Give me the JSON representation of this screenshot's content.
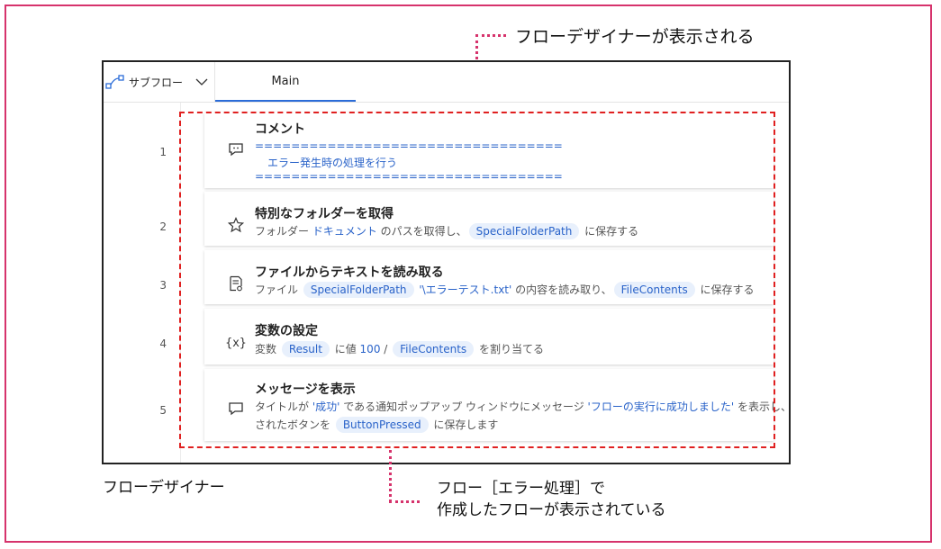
{
  "annotations": {
    "top_callout": "フローデザイナーが表示される",
    "designer_label": "フローデザイナー",
    "bottom_callout_line1": "フロー［エラー処理］で",
    "bottom_callout_line2": "作成したフローが表示されている"
  },
  "tabs": {
    "subflow_label": "サブフロー",
    "main_label": "Main"
  },
  "actions": [
    {
      "line": "1",
      "icon": "comment-icon",
      "title": "コメント",
      "separator": "==================================",
      "body": "エラー発生時の処理を行う"
    },
    {
      "line": "2",
      "icon": "star-icon",
      "title": "特別なフォルダーを取得",
      "desc": {
        "pre": "フォルダー ",
        "folder": "ドキュメント",
        "mid": " のパスを取得し、",
        "var": "SpecialFolderPath",
        "post": " に保存する"
      }
    },
    {
      "line": "3",
      "icon": "file-read-icon",
      "title": "ファイルからテキストを読み取る",
      "desc": {
        "pre": "ファイル ",
        "var1": "SpecialFolderPath",
        "path": " '\\エラーテスト.txt'",
        "mid": " の内容を読み取り、",
        "var2": "FileContents",
        "post": " に保存する"
      }
    },
    {
      "line": "4",
      "icon": "variable-icon",
      "title": "変数の設定",
      "desc": {
        "pre": "変数 ",
        "var1": "Result",
        "mid1": " に値 ",
        "value": "100",
        "mid2": " / ",
        "var2": "FileContents",
        "post": " を割り当てる"
      }
    },
    {
      "line": "5",
      "icon": "message-icon",
      "title": "メッセージを表示",
      "desc": {
        "pre": "タイトルが ",
        "title_val": "'成功'",
        "mid1": " である通知ポップアップ ウィンドウにメッセージ ",
        "msg": "'フローの実行に成功しました'",
        "mid2": " を表示し、押",
        "line2_pre": "されたボタンを ",
        "var": "ButtonPressed",
        "post": " に保存します"
      }
    }
  ],
  "colors": {
    "accent": "#2b6cd8",
    "frame": "#d6336c",
    "highlight_dash": "#e02020"
  }
}
